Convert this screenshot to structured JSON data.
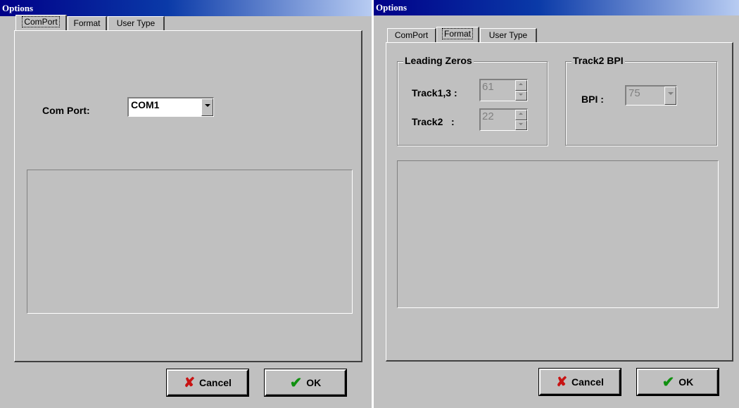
{
  "windows": [
    {
      "title": "Options",
      "tabs": [
        "ComPort",
        "Format",
        "User Type"
      ],
      "active_tab": "ComPort",
      "com_port": {
        "label": "Com Port:",
        "value": "COM1"
      },
      "buttons": {
        "cancel": "Cancel",
        "ok": "OK"
      }
    },
    {
      "title": "Options",
      "tabs": [
        "ComPort",
        "Format",
        "User Type"
      ],
      "active_tab": "Format",
      "leading_zeros": {
        "title": "Leading Zeros",
        "track13_label": "Track1,3 :",
        "track13_value": "61",
        "track2_label": "Track2   :",
        "track2_value": "22"
      },
      "track2_bpi": {
        "title": "Track2 BPI",
        "bpi_label": "BPI :",
        "bpi_value": "75"
      },
      "buttons": {
        "cancel": "Cancel",
        "ok": "OK"
      }
    }
  ],
  "icons": {
    "cancel": "red-x-icon",
    "ok": "green-check-icon"
  },
  "colors": {
    "title_start": "#000088",
    "title_end": "#b8ccf2",
    "face": "#c0c0c0",
    "cancel_icon": "#c81414",
    "ok_icon": "#109010"
  }
}
